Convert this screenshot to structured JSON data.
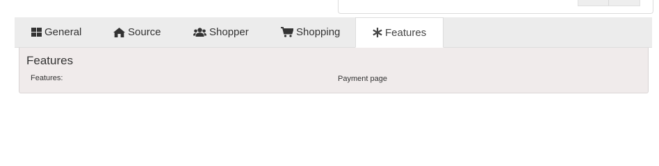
{
  "tabs": [
    {
      "label": "General",
      "icon": "grid-icon",
      "active": false
    },
    {
      "label": "Source",
      "icon": "home-icon",
      "active": false
    },
    {
      "label": "Shopper",
      "icon": "users-icon",
      "active": false
    },
    {
      "label": "Shopping",
      "icon": "cart-icon",
      "active": false
    },
    {
      "label": "Features",
      "icon": "asterisk-icon",
      "active": true
    }
  ],
  "panel": {
    "title": "Features",
    "rows": [
      {
        "label": "Features:",
        "value": "Payment page"
      }
    ]
  },
  "colors": {
    "tabbar_bg": "#ececec",
    "panel_bg": "#f0ebeb",
    "text": "#333333"
  }
}
